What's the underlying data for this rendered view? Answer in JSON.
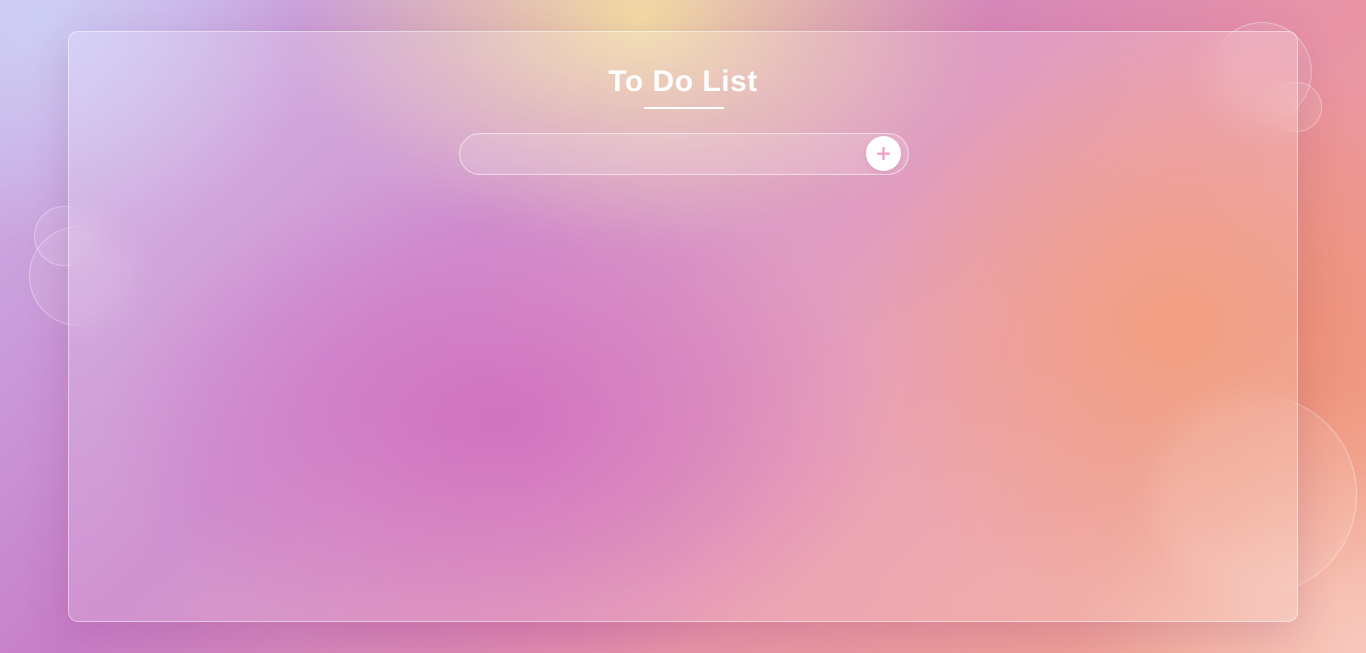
{
  "app": {
    "title": "To Do List"
  },
  "task_form": {
    "input_value": "",
    "input_placeholder": "",
    "add_button_label": "+",
    "add_button_icon": "plus-icon"
  },
  "tasks": [],
  "colors": {
    "title_text": "#ffffff",
    "add_button_bg": "#ffffff",
    "add_button_icon": "#f0a3c6"
  }
}
